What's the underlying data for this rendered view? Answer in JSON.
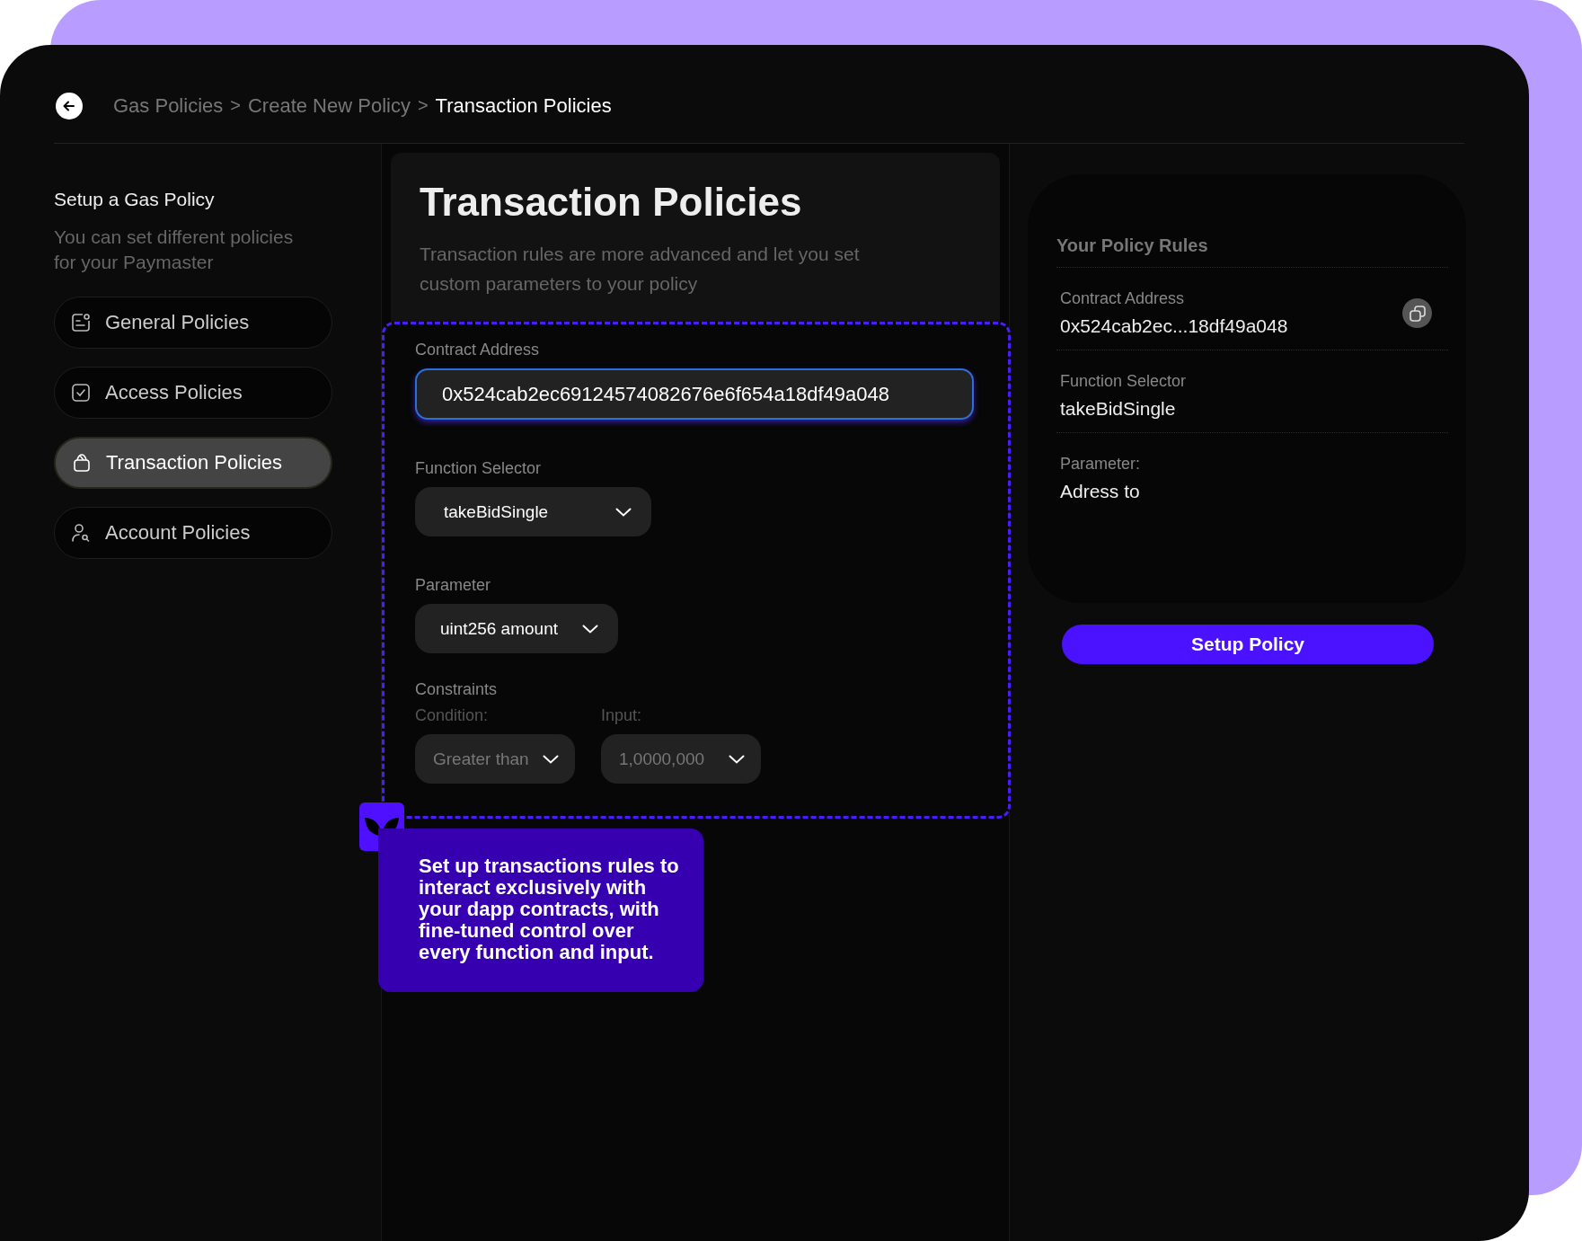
{
  "breadcrumb": {
    "separator": ">",
    "items": [
      {
        "label": "Gas Policies",
        "current": false
      },
      {
        "label": "Create New Policy",
        "current": false
      },
      {
        "label": "Transaction Policies",
        "current": true
      }
    ]
  },
  "sidebar": {
    "title": "Setup a Gas Policy",
    "subtitle": "You can set different policies for your Paymaster",
    "items": [
      {
        "label": "General Policies",
        "selected": false
      },
      {
        "label": "Access Policies",
        "selected": false
      },
      {
        "label": "Transaction Policies",
        "selected": true
      },
      {
        "label": "Account Policies",
        "selected": false
      }
    ]
  },
  "main": {
    "title": "Transaction Policies",
    "description": "Transaction rules are more advanced and let you set custom parameters to your policy",
    "contract_address": {
      "label": "Contract Address",
      "value": "0x524cab2ec69124574082676e6f654a18df49a048"
    },
    "function_selector": {
      "label": "Function Selector",
      "value": "takeBidSingle"
    },
    "parameter": {
      "label": "Parameter",
      "value": "uint256 amount"
    },
    "constraints": {
      "label": "Constraints",
      "condition": {
        "label": "Condition:",
        "value": "Greater than"
      },
      "input": {
        "label": "Input:",
        "value": "1,0000,000"
      }
    }
  },
  "tooltip": {
    "text": "Set up transactions rules to interact exclusively with your dapp contracts, with fine-tuned control over every function and input."
  },
  "rules": {
    "title": "Your Policy Rules",
    "items": [
      {
        "label": "Contract Address",
        "value": "0x524cab2ec...18df49a048",
        "copyable": true
      },
      {
        "label": "Function Selector",
        "value": "takeBidSingle",
        "copyable": false
      },
      {
        "label": "Parameter:",
        "value": "Adress to",
        "copyable": false
      }
    ]
  },
  "setup_button": "Setup Policy"
}
